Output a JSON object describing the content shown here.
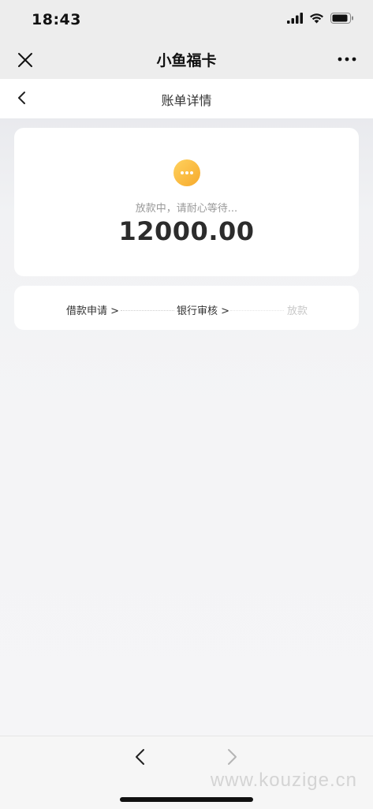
{
  "status_bar": {
    "time": "18:43"
  },
  "wechat_nav": {
    "title": "小鱼福卡"
  },
  "header": {
    "title": "账单详情"
  },
  "status_card": {
    "status_text": "放款中，请耐心等待...",
    "amount": "12000.00"
  },
  "progress": {
    "steps": [
      {
        "label": "借款申请 >",
        "state": "done"
      },
      {
        "label": "银行审核 >",
        "state": "done"
      },
      {
        "label": "放款",
        "state": "pending"
      }
    ]
  },
  "watermark": {
    "text": "www.kouzige.cn"
  },
  "colors": {
    "accent": "#f6a92c",
    "nav_background": "#ededed",
    "pending_step": "#c8c8c8"
  },
  "icons": {
    "close": "close-icon",
    "more": "more-icon",
    "back": "chevron-left-icon",
    "status": "ellipsis-icon",
    "forward": "chevron-right-icon"
  }
}
